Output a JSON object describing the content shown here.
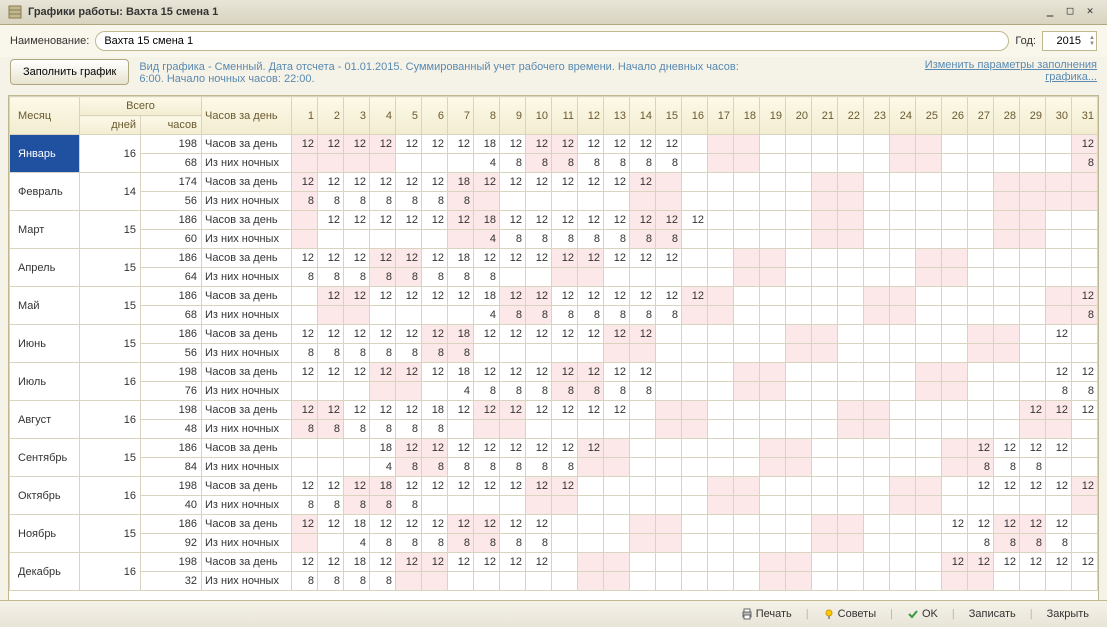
{
  "window": {
    "title": "Графики работы: Вахта 15 смена 1"
  },
  "form": {
    "name_label": "Наименование:",
    "name_value": "Вахта 15 смена 1",
    "year_label": "Год:",
    "year_value": "2015",
    "fill_button": "Заполнить график",
    "info_line1": "Вид графика - Сменный. Дата отсчета - 01.01.2015. Суммированный учет рабочего времени. Начало дневных часов:",
    "info_line2": "6:00. Начало ночных часов: 22:00.",
    "link_line1": "Изменить параметры заполнения",
    "link_line2": "графика..."
  },
  "headers": {
    "month": "Месяц",
    "total": "Всего",
    "days": "дней",
    "hours": "часов",
    "hours_per_day": "Часов за день"
  },
  "day_nums": [
    "1",
    "2",
    "3",
    "4",
    "5",
    "6",
    "7",
    "8",
    "9",
    "10",
    "11",
    "12",
    "13",
    "14",
    "15",
    "16",
    "17",
    "18",
    "19",
    "20",
    "21",
    "22",
    "23",
    "24",
    "25",
    "26",
    "27",
    "28",
    "29",
    "30",
    "31"
  ],
  "row_labels": {
    "day": "Часов за день",
    "night": "Из них ночных"
  },
  "months": [
    {
      "name": "Январь",
      "active": true,
      "days": "16",
      "hours": "198",
      "night_total": "68",
      "day_vals": {
        "1": "12",
        "2": "12",
        "3": "12",
        "4": "12",
        "5": "12",
        "6": "12",
        "7": "12",
        "8": "18",
        "9": "12",
        "10": "12",
        "11": "12",
        "12": "12",
        "13": "12",
        "14": "12",
        "15": "12",
        "31": "12"
      },
      "day_pink": [
        "1",
        "2",
        "3",
        "4",
        "10",
        "11",
        "17",
        "18",
        "24",
        "25",
        "31"
      ],
      "night_vals": {
        "8": "4",
        "9": "8",
        "10": "8",
        "11": "8",
        "12": "8",
        "13": "8",
        "14": "8",
        "15": "8",
        "31": "8"
      },
      "night_pink": [
        "1",
        "2",
        "3",
        "4",
        "10",
        "11",
        "17",
        "18",
        "24",
        "25",
        "31"
      ]
    },
    {
      "name": "Февраль",
      "days": "14",
      "hours": "174",
      "night_total": "56",
      "day_vals": {
        "1": "12",
        "2": "12",
        "3": "12",
        "4": "12",
        "5": "12",
        "6": "12",
        "7": "18",
        "8": "12",
        "9": "12",
        "10": "12",
        "11": "12",
        "12": "12",
        "13": "12",
        "14": "12"
      },
      "day_pink": [
        "1",
        "7",
        "8",
        "14",
        "15",
        "21",
        "22",
        "28",
        "29",
        "30",
        "31"
      ],
      "night_vals": {
        "1": "8",
        "2": "8",
        "3": "8",
        "4": "8",
        "5": "8",
        "6": "8",
        "7": "8"
      },
      "night_pink": [
        "1",
        "7",
        "8",
        "14",
        "15",
        "21",
        "22",
        "28",
        "29",
        "30",
        "31"
      ]
    },
    {
      "name": "Март",
      "days": "15",
      "hours": "186",
      "night_total": "60",
      "day_vals": {
        "2": "12",
        "3": "12",
        "4": "12",
        "5": "12",
        "6": "12",
        "7": "12",
        "8": "18",
        "9": "12",
        "10": "12",
        "11": "12",
        "12": "12",
        "13": "12",
        "14": "12",
        "15": "12",
        "16": "12"
      },
      "day_pink": [
        "1",
        "7",
        "8",
        "14",
        "15",
        "21",
        "22",
        "28",
        "29"
      ],
      "night_vals": {
        "8": "4",
        "9": "8",
        "10": "8",
        "11": "8",
        "12": "8",
        "13": "8",
        "14": "8",
        "15": "8"
      },
      "night_pink": [
        "1",
        "7",
        "8",
        "14",
        "15",
        "21",
        "22",
        "28",
        "29"
      ]
    },
    {
      "name": "Апрель",
      "days": "15",
      "hours": "186",
      "night_total": "64",
      "day_vals": {
        "1": "12",
        "2": "12",
        "3": "12",
        "4": "12",
        "5": "12",
        "6": "12",
        "7": "18",
        "8": "12",
        "9": "12",
        "10": "12",
        "11": "12",
        "12": "12",
        "13": "12",
        "14": "12",
        "15": "12"
      },
      "day_pink": [
        "4",
        "5",
        "11",
        "12",
        "18",
        "19",
        "25",
        "26"
      ],
      "night_vals": {
        "1": "8",
        "2": "8",
        "3": "8",
        "4": "8",
        "5": "8",
        "6": "8",
        "7": "8",
        "8": "8"
      },
      "night_pink": [
        "4",
        "5",
        "11",
        "12",
        "18",
        "19",
        "25",
        "26"
      ]
    },
    {
      "name": "Май",
      "days": "15",
      "hours": "186",
      "night_total": "68",
      "day_vals": {
        "2": "12",
        "3": "12",
        "4": "12",
        "5": "12",
        "6": "12",
        "7": "12",
        "8": "18",
        "9": "12",
        "10": "12",
        "11": "12",
        "12": "12",
        "13": "12",
        "14": "12",
        "15": "12",
        "16": "12",
        "31": "12"
      },
      "day_pink": [
        "2",
        "3",
        "9",
        "10",
        "16",
        "17",
        "23",
        "24",
        "30",
        "31"
      ],
      "night_vals": {
        "8": "4",
        "9": "8",
        "10": "8",
        "11": "8",
        "12": "8",
        "13": "8",
        "14": "8",
        "15": "8",
        "31": "8"
      },
      "night_pink": [
        "2",
        "3",
        "9",
        "10",
        "16",
        "17",
        "23",
        "24",
        "30",
        "31"
      ]
    },
    {
      "name": "Июнь",
      "days": "15",
      "hours": "186",
      "night_total": "56",
      "day_vals": {
        "1": "12",
        "2": "12",
        "3": "12",
        "4": "12",
        "5": "12",
        "6": "12",
        "7": "18",
        "8": "12",
        "9": "12",
        "10": "12",
        "11": "12",
        "12": "12",
        "13": "12",
        "14": "12",
        "30": "12"
      },
      "day_pink": [
        "6",
        "7",
        "13",
        "14",
        "20",
        "21",
        "27",
        "28"
      ],
      "night_vals": {
        "1": "8",
        "2": "8",
        "3": "8",
        "4": "8",
        "5": "8",
        "6": "8",
        "7": "8"
      },
      "night_pink": [
        "6",
        "7",
        "13",
        "14",
        "20",
        "21",
        "27",
        "28"
      ]
    },
    {
      "name": "Июль",
      "days": "16",
      "hours": "198",
      "night_total": "76",
      "day_vals": {
        "1": "12",
        "2": "12",
        "3": "12",
        "4": "12",
        "5": "12",
        "6": "12",
        "7": "18",
        "8": "12",
        "9": "12",
        "10": "12",
        "11": "12",
        "12": "12",
        "13": "12",
        "14": "12",
        "30": "12",
        "31": "12"
      },
      "day_pink": [
        "4",
        "5",
        "11",
        "12",
        "18",
        "19",
        "25",
        "26"
      ],
      "night_vals": {
        "7": "4",
        "8": "8",
        "9": "8",
        "10": "8",
        "11": "8",
        "12": "8",
        "13": "8",
        "14": "8",
        "30": "8",
        "31": "8"
      },
      "night_pink": [
        "4",
        "5",
        "11",
        "12",
        "18",
        "19",
        "25",
        "26"
      ]
    },
    {
      "name": "Август",
      "days": "16",
      "hours": "198",
      "night_total": "48",
      "day_vals": {
        "1": "12",
        "2": "12",
        "3": "12",
        "4": "12",
        "5": "12",
        "6": "18",
        "7": "12",
        "8": "12",
        "9": "12",
        "10": "12",
        "11": "12",
        "12": "12",
        "13": "12",
        "29": "12",
        "30": "12",
        "31": "12"
      },
      "day_pink": [
        "1",
        "2",
        "8",
        "9",
        "15",
        "16",
        "22",
        "23",
        "29",
        "30"
      ],
      "night_vals": {
        "1": "8",
        "2": "8",
        "3": "8",
        "4": "8",
        "5": "8",
        "6": "8"
      },
      "night_pink": [
        "1",
        "2",
        "8",
        "9",
        "15",
        "16",
        "22",
        "23",
        "29",
        "30"
      ]
    },
    {
      "name": "Сентябрь",
      "days": "15",
      "hours": "186",
      "night_total": "84",
      "day_vals": {
        "4": "18",
        "5": "12",
        "6": "12",
        "7": "12",
        "8": "12",
        "9": "12",
        "10": "12",
        "11": "12",
        "12": "12",
        "27": "12",
        "28": "12",
        "29": "12",
        "30": "12"
      },
      "day_pink": [
        "5",
        "6",
        "12",
        "13",
        "19",
        "20",
        "26",
        "27"
      ],
      "night_vals": {
        "4": "4",
        "5": "8",
        "6": "8",
        "7": "8",
        "8": "8",
        "9": "8",
        "10": "8",
        "11": "8",
        "27": "8",
        "28": "8",
        "29": "8"
      },
      "night_pink": [
        "5",
        "6",
        "12",
        "13",
        "19",
        "20",
        "26",
        "27"
      ]
    },
    {
      "name": "Октябрь",
      "days": "16",
      "hours": "198",
      "night_total": "40",
      "day_vals": {
        "1": "12",
        "2": "12",
        "3": "12",
        "4": "18",
        "5": "12",
        "6": "12",
        "7": "12",
        "8": "12",
        "9": "12",
        "10": "12",
        "11": "12",
        "27": "12",
        "28": "12",
        "29": "12",
        "30": "12",
        "31": "12"
      },
      "day_pink": [
        "3",
        "4",
        "10",
        "11",
        "17",
        "18",
        "24",
        "25",
        "31"
      ],
      "night_vals": {
        "1": "8",
        "2": "8",
        "3": "8",
        "4": "8",
        "5": "8"
      },
      "night_pink": [
        "3",
        "4",
        "10",
        "11",
        "17",
        "18",
        "24",
        "25",
        "31"
      ]
    },
    {
      "name": "Ноябрь",
      "days": "15",
      "hours": "186",
      "night_total": "92",
      "day_vals": {
        "1": "12",
        "2": "12",
        "3": "18",
        "4": "12",
        "5": "12",
        "6": "12",
        "7": "12",
        "8": "12",
        "9": "12",
        "10": "12",
        "26": "12",
        "27": "12",
        "28": "12",
        "29": "12",
        "30": "12"
      },
      "day_pink": [
        "1",
        "7",
        "8",
        "14",
        "15",
        "21",
        "22",
        "28",
        "29"
      ],
      "night_vals": {
        "3": "4",
        "4": "8",
        "5": "8",
        "6": "8",
        "7": "8",
        "8": "8",
        "9": "8",
        "10": "8",
        "27": "8",
        "28": "8",
        "29": "8",
        "30": "8"
      },
      "night_pink": [
        "1",
        "7",
        "8",
        "14",
        "15",
        "21",
        "22",
        "28",
        "29"
      ]
    },
    {
      "name": "Декабрь",
      "days": "16",
      "hours": "198",
      "night_total": "32",
      "day_vals": {
        "1": "12",
        "2": "12",
        "3": "18",
        "4": "12",
        "5": "12",
        "6": "12",
        "7": "12",
        "8": "12",
        "9": "12",
        "10": "12",
        "26": "12",
        "27": "12",
        "28": "12",
        "29": "12",
        "30": "12",
        "31": "12"
      },
      "day_pink": [
        "5",
        "6",
        "12",
        "13",
        "19",
        "20",
        "26",
        "27"
      ],
      "night_vals": {
        "1": "8",
        "2": "8",
        "3": "8",
        "4": "8"
      },
      "night_pink": [
        "5",
        "6",
        "12",
        "13",
        "19",
        "20",
        "26",
        "27"
      ]
    }
  ],
  "footer": {
    "print": "Печать",
    "tips": "Советы",
    "ok": "OK",
    "save": "Записать",
    "close": "Закрыть"
  }
}
